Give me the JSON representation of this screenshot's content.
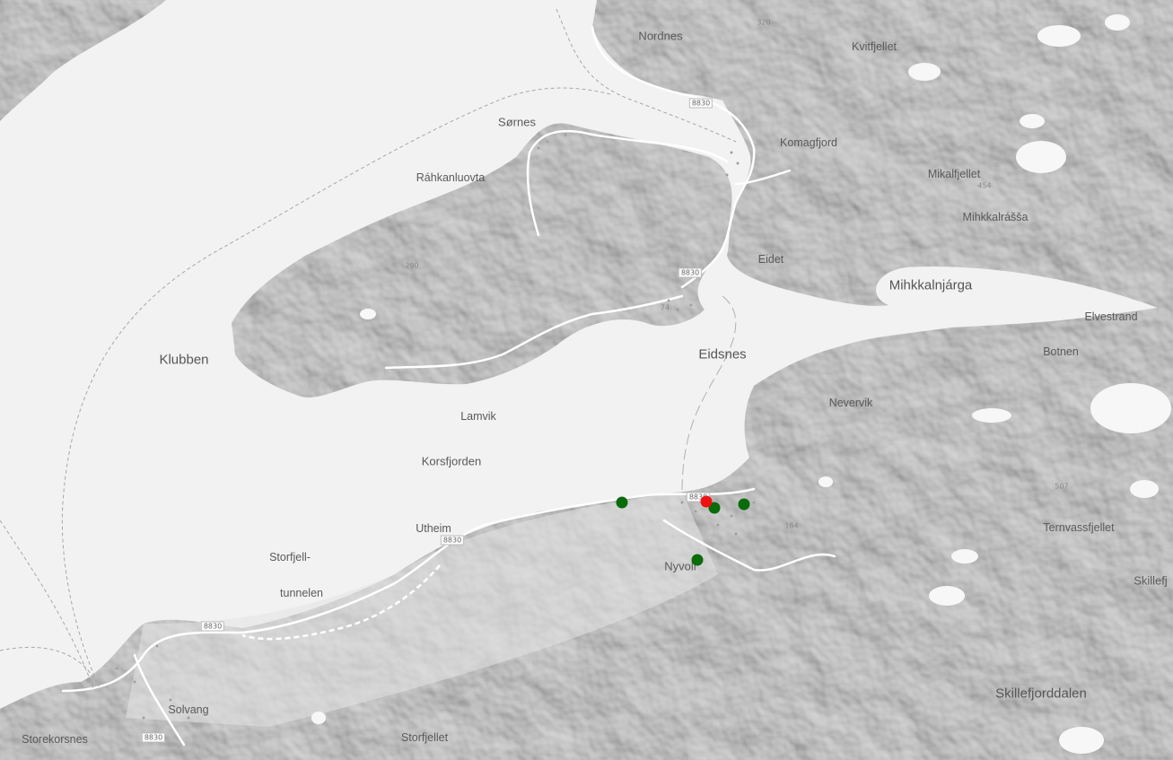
{
  "map": {
    "colors": {
      "water": "#f2f2f2",
      "land": "#d8d8d8",
      "land_light": "#e2e2e2",
      "road": "#ffffff",
      "marker_green": "#0a6b0a",
      "marker_red": "#ee1111"
    },
    "places": {
      "nordnes": "Nordnes",
      "kvitfjellet": "Kvitfjellet",
      "sornes": "Sørnes",
      "komagfjord": "Komagfjord",
      "rahkanluovta": "Ráhkanluovta",
      "mikalfjellet": "Mikalfjellet",
      "mihkkalrassa": "Mihkkalrášša",
      "eidet": "Eidet",
      "mihkkalnjarga": "Mihkkalnjárga",
      "elvestrand": "Elvestrand",
      "klubben": "Klubben",
      "eidsnes": "Eidsnes",
      "botnen": "Botnen",
      "nevervik": "Nevervik",
      "lamvik": "Lamvik",
      "korsfjorden": "Korsfjorden",
      "utheim": "Utheim",
      "storfjell": "Storfjell-",
      "tunnelen": "tunnelen",
      "nyvoll": "Nyvoll",
      "ternvassfjellet": "Ternvassfjellet",
      "skillefj": "Skillefj",
      "skillefjorddalen": "Skillefjorddalen",
      "solvang": "Solvang",
      "storekorsnes": "Storekorsnes",
      "storfjellet": "Storfjellet"
    },
    "roads": {
      "r1": "8830",
      "r2": "8830",
      "r3": "8830",
      "r4": "8830",
      "r5": "8830",
      "r6": "8830"
    },
    "elevations": {
      "e1": "320",
      "e2": "454",
      "e3": "290",
      "e4": "74",
      "e5": "164",
      "e6": "507"
    },
    "markers": [
      {
        "label": "green-marker",
        "color": "green"
      },
      {
        "label": "red-marker",
        "color": "red"
      },
      {
        "label": "green-marker",
        "color": "green"
      },
      {
        "label": "green-marker",
        "color": "green"
      },
      {
        "label": "green-marker",
        "color": "green"
      }
    ]
  }
}
